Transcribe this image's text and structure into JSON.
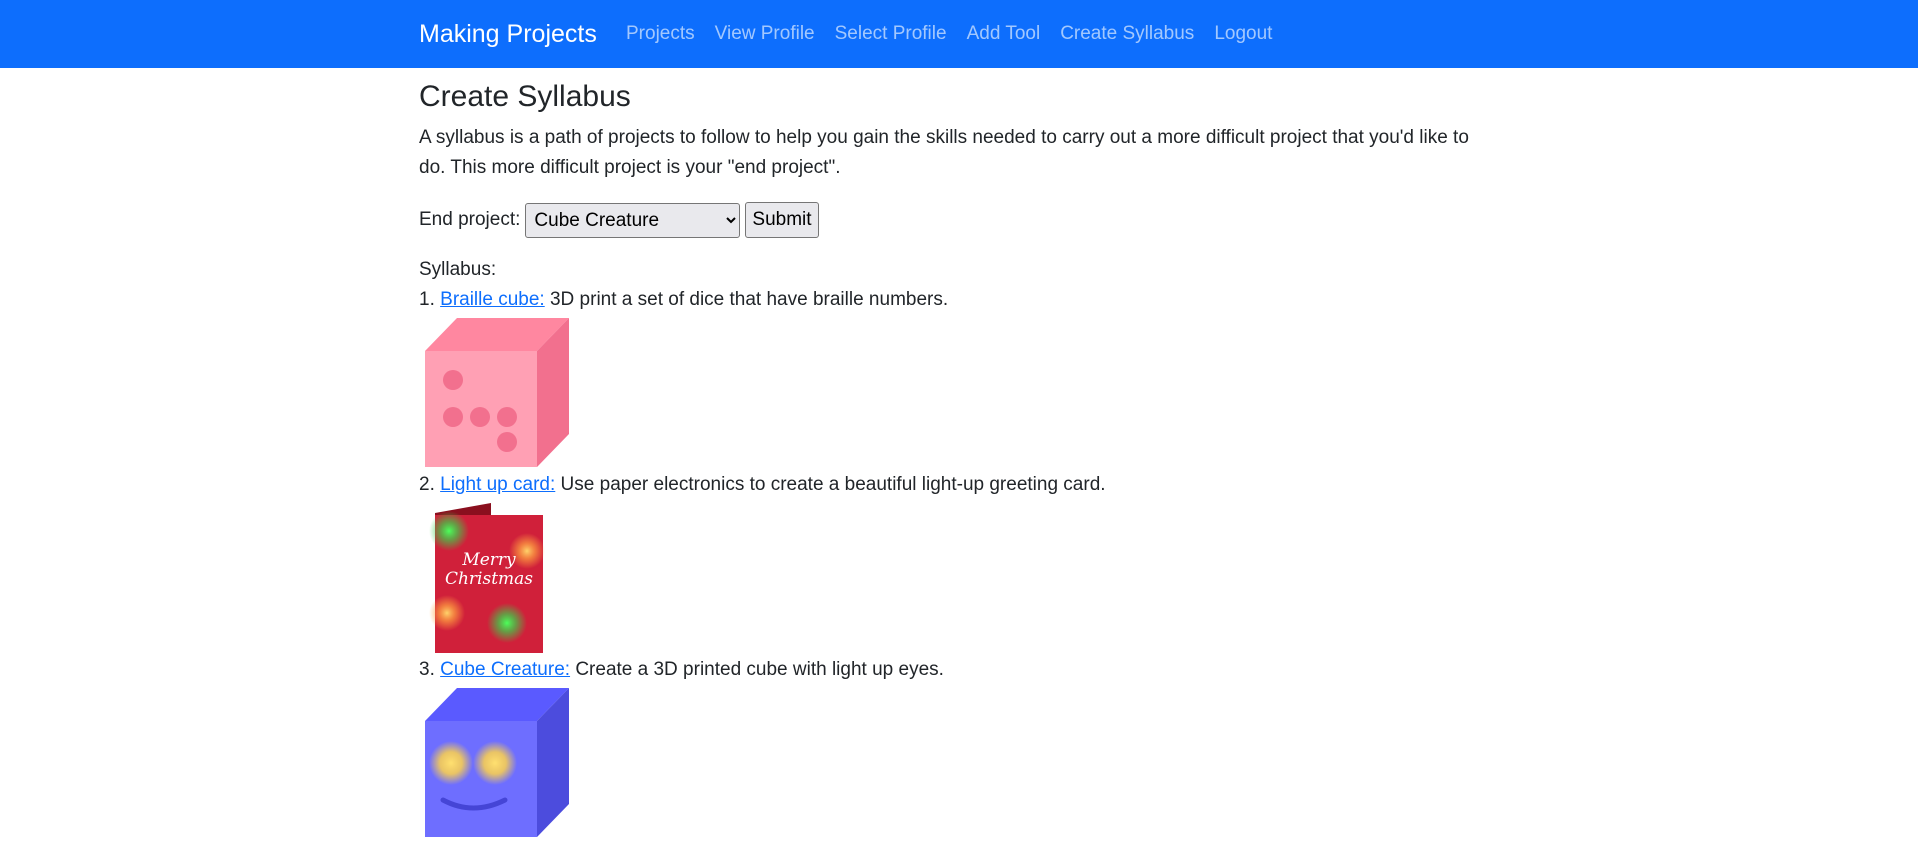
{
  "navbar": {
    "brand": "Making Projects",
    "links": [
      {
        "label": "Projects"
      },
      {
        "label": "View Profile"
      },
      {
        "label": "Select Profile"
      },
      {
        "label": "Add Tool"
      },
      {
        "label": "Create Syllabus"
      },
      {
        "label": "Logout"
      }
    ]
  },
  "page": {
    "title": "Create Syllabus",
    "intro": "A syllabus is a path of projects to follow to help you gain the skills needed to carry out a more difficult project that you'd like to do. This more difficult project is your \"end project\"."
  },
  "form": {
    "end_project_label": "End project:",
    "selected_value": "Cube Creature",
    "submit_label": "Submit"
  },
  "syllabus": {
    "heading": "Syllabus:",
    "items": [
      {
        "number": "1.",
        "link": "Braille cube:",
        "description": " 3D print a set of dice that have braille numbers.",
        "image_icon": "pink-braille-cube"
      },
      {
        "number": "2.",
        "link": "Light up card:",
        "description": " Use paper electronics to create a beautiful light-up greeting card.",
        "image_icon": "christmas-card",
        "card_text_1": "Merry",
        "card_text_2": "Christmas"
      },
      {
        "number": "3.",
        "link": "Cube Creature:",
        "description": " Create a 3D printed cube with light up eyes.",
        "image_icon": "blue-cube-creature"
      }
    ]
  },
  "colors": {
    "navbar": "#0d6efd",
    "link": "#0d6efd",
    "cube_pink": "#ff9fb4",
    "card_red": "#d0203a",
    "cube_blue": "#6a6aff"
  }
}
